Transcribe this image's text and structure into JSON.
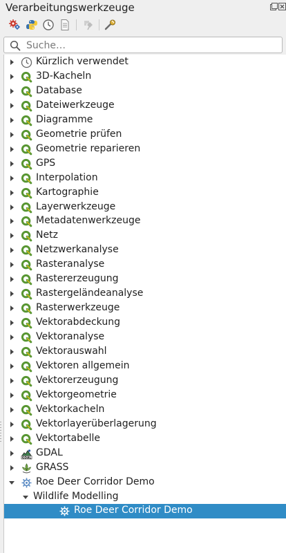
{
  "panel": {
    "title": "Verarbeitungswerkzeuge"
  },
  "toolbar": {
    "buttons": [
      {
        "icon": "models-gear-icon"
      },
      {
        "icon": "python-icon"
      },
      {
        "icon": "history-clock-icon"
      },
      {
        "icon": "results-document-icon"
      },
      {
        "icon": "edit-in-place-icon"
      },
      {
        "icon": "options-wrench-icon"
      }
    ]
  },
  "search": {
    "placeholder": "Suche…",
    "value": ""
  },
  "tree": {
    "items": [
      {
        "label": "Kürzlich verwendet",
        "icon": "clock-icon"
      },
      {
        "label": "3D-Kacheln",
        "icon": "qgis-icon"
      },
      {
        "label": "Database",
        "icon": "qgis-icon"
      },
      {
        "label": "Dateiwerkzeuge",
        "icon": "qgis-icon"
      },
      {
        "label": "Diagramme",
        "icon": "qgis-icon"
      },
      {
        "label": "Geometrie prüfen",
        "icon": "qgis-icon"
      },
      {
        "label": "Geometrie reparieren",
        "icon": "qgis-icon"
      },
      {
        "label": "GPS",
        "icon": "qgis-icon"
      },
      {
        "label": "Interpolation",
        "icon": "qgis-icon"
      },
      {
        "label": "Kartographie",
        "icon": "qgis-icon"
      },
      {
        "label": "Layerwerkzeuge",
        "icon": "qgis-icon"
      },
      {
        "label": "Metadatenwerkzeuge",
        "icon": "qgis-icon"
      },
      {
        "label": "Netz",
        "icon": "qgis-icon"
      },
      {
        "label": "Netzwerkanalyse",
        "icon": "qgis-icon"
      },
      {
        "label": "Rasteranalyse",
        "icon": "qgis-icon"
      },
      {
        "label": "Rastererzeugung",
        "icon": "qgis-icon"
      },
      {
        "label": "Rastergeländeanalyse",
        "icon": "qgis-icon"
      },
      {
        "label": "Rasterwerkzeuge",
        "icon": "qgis-icon"
      },
      {
        "label": "Vektorabdeckung",
        "icon": "qgis-icon"
      },
      {
        "label": "Vektoranalyse",
        "icon": "qgis-icon"
      },
      {
        "label": "Vektorauswahl",
        "icon": "qgis-icon"
      },
      {
        "label": "Vektoren allgemein",
        "icon": "qgis-icon"
      },
      {
        "label": "Vektorerzeugung",
        "icon": "qgis-icon"
      },
      {
        "label": "Vektorgeometrie",
        "icon": "qgis-icon"
      },
      {
        "label": "Vektorkacheln",
        "icon": "qgis-icon"
      },
      {
        "label": "Vektorlayerüberlagerung",
        "icon": "qgis-icon"
      },
      {
        "label": "Vektortabelle",
        "icon": "qgis-icon"
      },
      {
        "label": "GDAL",
        "icon": "gdal-icon"
      },
      {
        "label": "GRASS",
        "icon": "grass-icon"
      },
      {
        "label": "Roe Deer Corridor Demo",
        "icon": "model-gear-icon",
        "expanded": true
      },
      {
        "label": "Wildlife Modelling",
        "expanded": true
      },
      {
        "label": "Roe Deer Corridor Demo",
        "icon": "model-gear-icon",
        "selected": true
      }
    ]
  }
}
